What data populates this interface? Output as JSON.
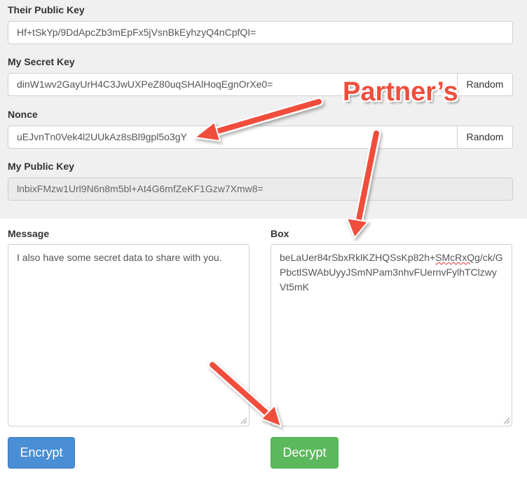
{
  "keys": {
    "their_public_key": {
      "label": "Their Public Key",
      "value": "Hf+tSkYp/9DdApcZb3mEpFx5jVsnBkEyhzyQ4nCpfQI="
    },
    "my_secret_key": {
      "label": "My Secret Key",
      "value": "dinW1wv2GayUrH4C3JwUXPeZ80uqSHAlHoqEgnOrXe0=",
      "random_label": "Random"
    },
    "nonce": {
      "label": "Nonce",
      "value": "uEJvnTn0Vek4l2UUkAz8sBl9gpl5o3gY",
      "random_label": "Random"
    },
    "my_public_key": {
      "label": "My Public Key",
      "value": "lnbixFMzw1Url9N6n8m5bl+At4G6mfZeKF1Gzw7Xmw8="
    }
  },
  "message": {
    "label": "Message",
    "value": "I also have some secret data to share with you."
  },
  "box": {
    "label": "Box",
    "value_prefix": "beLaUer84rSbxRklKZHQSsKp82h+",
    "value_misspelled": "SMcRxQg",
    "value_suffix": "/ck/GPbctlSWAbUyyJSmNPam3nhvFUernvFylhTClzwyVt5mK"
  },
  "buttons": {
    "encrypt_label": "Encrypt",
    "decrypt_label": "Decrypt"
  },
  "annotation": {
    "text": "Partner’s"
  },
  "colors": {
    "arrow": "#f04e3c",
    "encrypt": "#4a8ed3",
    "decrypt": "#5cb85c",
    "panel": "#f0f0f0"
  }
}
